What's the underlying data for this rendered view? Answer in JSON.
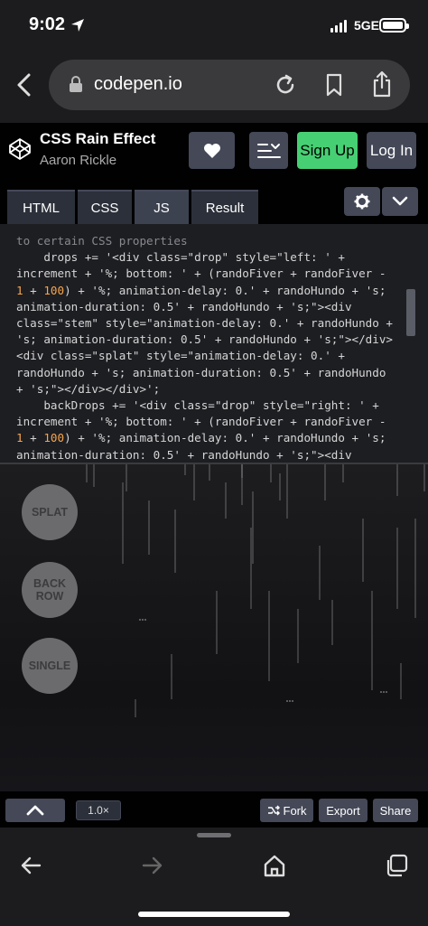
{
  "status": {
    "time": "9:02",
    "network": "5GE"
  },
  "browser": {
    "url": "codepen.io"
  },
  "pen": {
    "title": "CSS Rain Effect",
    "author": "Aaron Rickle",
    "signup_label": "Sign Up",
    "login_label": "Log In"
  },
  "tabs": [
    {
      "label": "HTML"
    },
    {
      "label": "CSS"
    },
    {
      "label": "JS",
      "active": true
    },
    {
      "label": "Result"
    }
  ],
  "code_lines": [
    "to certain CSS properties",
    "    drops += '<div class=\"drop\" style=\"left: ' +",
    "increment + '%; bottom: ' + (randoFiver + randoFiver -",
    "1 + 100) + '%; animation-delay: 0.' + randoHundo + 's;",
    "animation-duration: 0.5' + randoHundo + 's;\"><div",
    "class=\"stem\" style=\"animation-delay: 0.' + randoHundo +",
    "'s; animation-duration: 0.5' + randoHundo + 's;\"></div>",
    "<div class=\"splat\" style=\"animation-delay: 0.' +",
    "randoHundo + 's; animation-duration: 0.5' + randoHundo",
    "+ 's;\"></div></div>';",
    "    backDrops += '<div class=\"drop\" style=\"right: ' +",
    "increment + '%; bottom: ' + (randoFiver + randoFiver -",
    "1 + 100) + '%; animation-delay: 0.' + randoHundo + 's;",
    "animation-duration: 0.5' + randoHundo + 's;\"><div"
  ],
  "result": {
    "splat_label": "SPLAT",
    "back_row_label": "BACK ROW",
    "single_label": "SINGLE"
  },
  "bottom_bar": {
    "zoom": "1.0×",
    "fork_label": "Fork",
    "export_label": "Export",
    "share_label": "Share"
  },
  "colors": {
    "signup_green": "#47cf73",
    "button_gray": "#444857",
    "header_black": "#010101"
  },
  "icons": [
    "location-arrow-icon",
    "signal-icon",
    "battery-icon",
    "back-chevron-icon",
    "lock-icon",
    "reload-icon",
    "bookmark-icon",
    "share-icon",
    "codepen-logo-icon",
    "heart-icon",
    "layout-icon",
    "gear-icon",
    "chevron-down-icon",
    "chevron-up-icon",
    "fork-icon",
    "back-arrow-icon",
    "forward-arrow-icon",
    "home-icon",
    "tabs-icon"
  ]
}
